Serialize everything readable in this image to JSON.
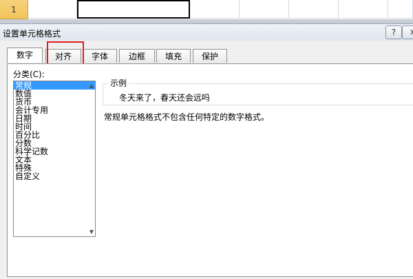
{
  "sheet": {
    "row_number": "1"
  },
  "dialog": {
    "title": "设置单元格格式",
    "help_label": "?",
    "close_label": "✕"
  },
  "tabs": [
    {
      "label": "数字",
      "active": true
    },
    {
      "label": "对齐",
      "highlighted": true
    },
    {
      "label": "字体"
    },
    {
      "label": "边框"
    },
    {
      "label": "填充"
    },
    {
      "label": "保护"
    }
  ],
  "category": {
    "label": "分类(C):",
    "items": [
      "常规",
      "数值",
      "货币",
      "会计专用",
      "日期",
      "时间",
      "百分比",
      "分数",
      "科学记数",
      "文本",
      "特殊",
      "自定义"
    ],
    "selected": "常规"
  },
  "sample": {
    "legend": "示例",
    "value": "冬天来了，春天还会远吗"
  },
  "description": "常规单元格格式不包含任何特定的数字格式。",
  "colors": {
    "highlight": "#e01b1b",
    "selection": "#3399ff"
  }
}
